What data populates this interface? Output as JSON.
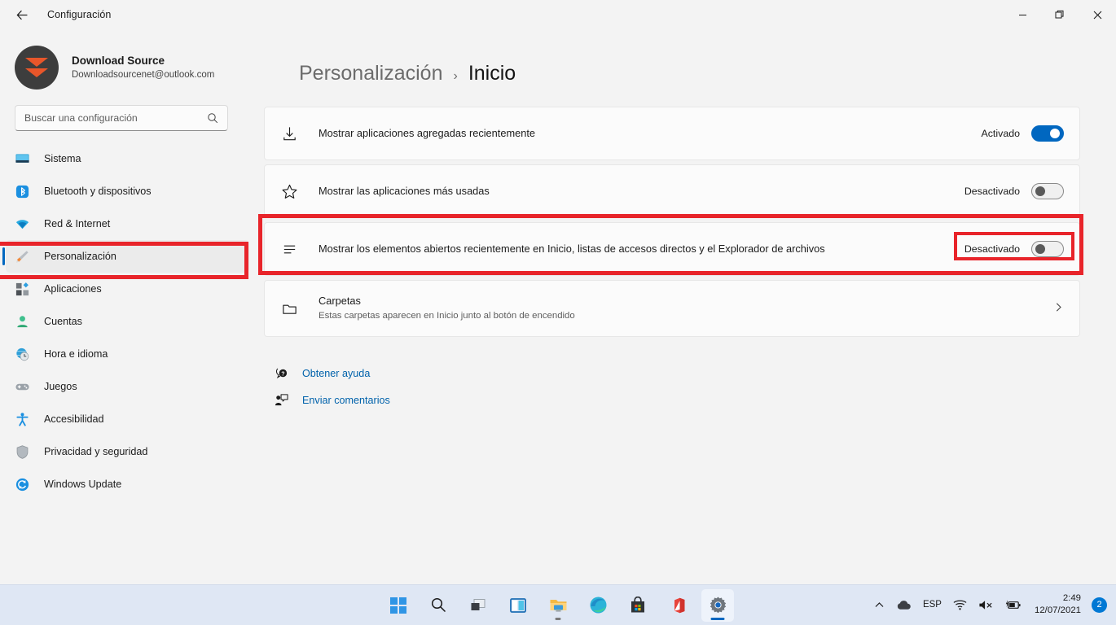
{
  "window": {
    "title": "Configuración",
    "back_label": "back-arrow",
    "minimize_label": "Minimizar",
    "maximize_label": "Restaurar",
    "close_label": "Cerrar"
  },
  "profile": {
    "name": "Download Source",
    "email": "Downloadsourcenet@outlook.com"
  },
  "search": {
    "placeholder": "Buscar una configuración",
    "value": ""
  },
  "sidebar": {
    "items": [
      {
        "label": "Sistema",
        "icon": "monitor-icon",
        "active": false
      },
      {
        "label": "Bluetooth y dispositivos",
        "icon": "bluetooth-icon",
        "active": false
      },
      {
        "label": "Red & Internet",
        "icon": "wifi-icon",
        "active": false
      },
      {
        "label": "Personalización",
        "icon": "paintbrush-icon",
        "active": true
      },
      {
        "label": "Aplicaciones",
        "icon": "apps-icon",
        "active": false
      },
      {
        "label": "Cuentas",
        "icon": "person-icon",
        "active": false
      },
      {
        "label": "Hora e idioma",
        "icon": "clock-globe-icon",
        "active": false
      },
      {
        "label": "Juegos",
        "icon": "gamepad-icon",
        "active": false
      },
      {
        "label": "Accesibilidad",
        "icon": "accessibility-icon",
        "active": false
      },
      {
        "label": "Privacidad y seguridad",
        "icon": "shield-icon",
        "active": false
      },
      {
        "label": "Windows Update",
        "icon": "update-icon",
        "active": false
      }
    ]
  },
  "breadcrumb": {
    "parent": "Personalización",
    "separator": "›",
    "current": "Inicio"
  },
  "settings_rows": [
    {
      "icon": "download-icon",
      "title": "Mostrar aplicaciones agregadas recientemente",
      "subtitle": "",
      "control": "toggle",
      "state_label": "Activado",
      "state": "on"
    },
    {
      "icon": "star-icon",
      "title": "Mostrar las aplicaciones más usadas",
      "subtitle": "",
      "control": "toggle",
      "state_label": "Desactivado",
      "state": "off"
    },
    {
      "icon": "list-icon",
      "title": "Mostrar los elementos abiertos recientemente en Inicio, listas de accesos directos y el Explorador de archivos",
      "subtitle": "",
      "control": "toggle",
      "state_label": "Desactivado",
      "state": "off",
      "highlighted": true
    },
    {
      "icon": "folder-icon",
      "title": "Carpetas",
      "subtitle": "Estas carpetas aparecen en Inicio junto al botón de encendido",
      "control": "chevron",
      "state_label": "",
      "state": ""
    }
  ],
  "help_links": [
    {
      "label": "Obtener ayuda",
      "icon": "help-icon"
    },
    {
      "label": "Enviar comentarios",
      "icon": "feedback-icon"
    }
  ],
  "taskbar": {
    "icons": [
      {
        "name": "start-icon",
        "label": "Inicio",
        "state": ""
      },
      {
        "name": "search-icon",
        "label": "Buscar",
        "state": ""
      },
      {
        "name": "task-view-icon",
        "label": "Vista de tareas",
        "state": ""
      },
      {
        "name": "widgets-icon",
        "label": "Widgets",
        "state": ""
      },
      {
        "name": "file-explorer-icon",
        "label": "Explorador de archivos",
        "state": "running"
      },
      {
        "name": "edge-icon",
        "label": "Microsoft Edge",
        "state": ""
      },
      {
        "name": "store-icon",
        "label": "Microsoft Store",
        "state": ""
      },
      {
        "name": "office-icon",
        "label": "Office",
        "state": ""
      },
      {
        "name": "settings-icon",
        "label": "Configuración",
        "state": "active"
      }
    ],
    "tray": {
      "overflow": "chevron-up-icon",
      "onedrive": "cloud-icon",
      "language": "ESP",
      "wifi": "wifi-icon",
      "volume": "speaker-muted-icon",
      "battery": "battery-charging-icon",
      "time": "2:49",
      "date": "12/07/2021",
      "notifications": "2"
    }
  },
  "colors": {
    "accent": "#0067c0",
    "page_bg": "#f3f3f3",
    "card_bg": "#fbfbfb",
    "annotation": "#e8242a",
    "link": "#0062ab",
    "taskbar_bg": "#dfe7f4"
  }
}
